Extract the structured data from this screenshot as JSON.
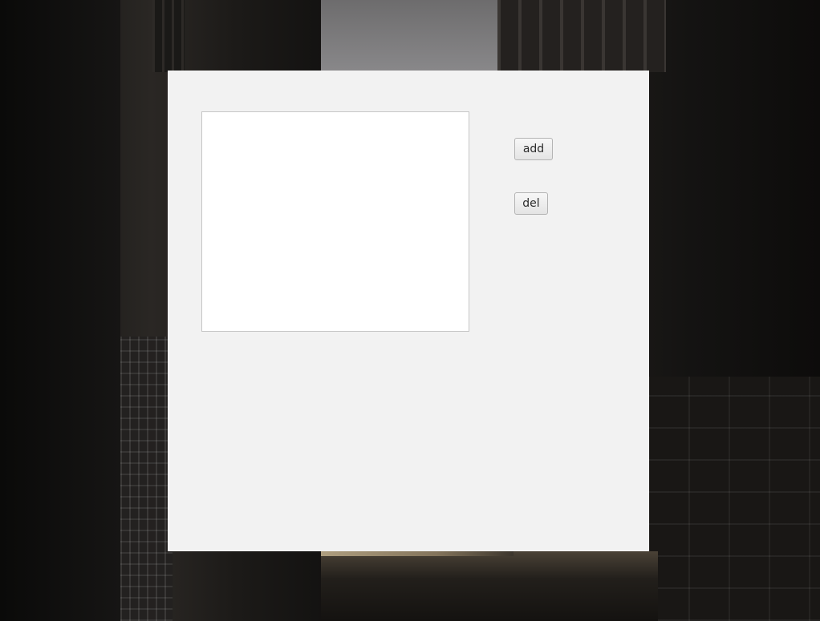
{
  "window": {
    "list_items": []
  },
  "buttons": {
    "add_label": "add",
    "del_label": "del"
  },
  "colors": {
    "window_background": "#f2f2f2",
    "list_background": "#ffffff",
    "list_border": "#c6c6c6"
  }
}
